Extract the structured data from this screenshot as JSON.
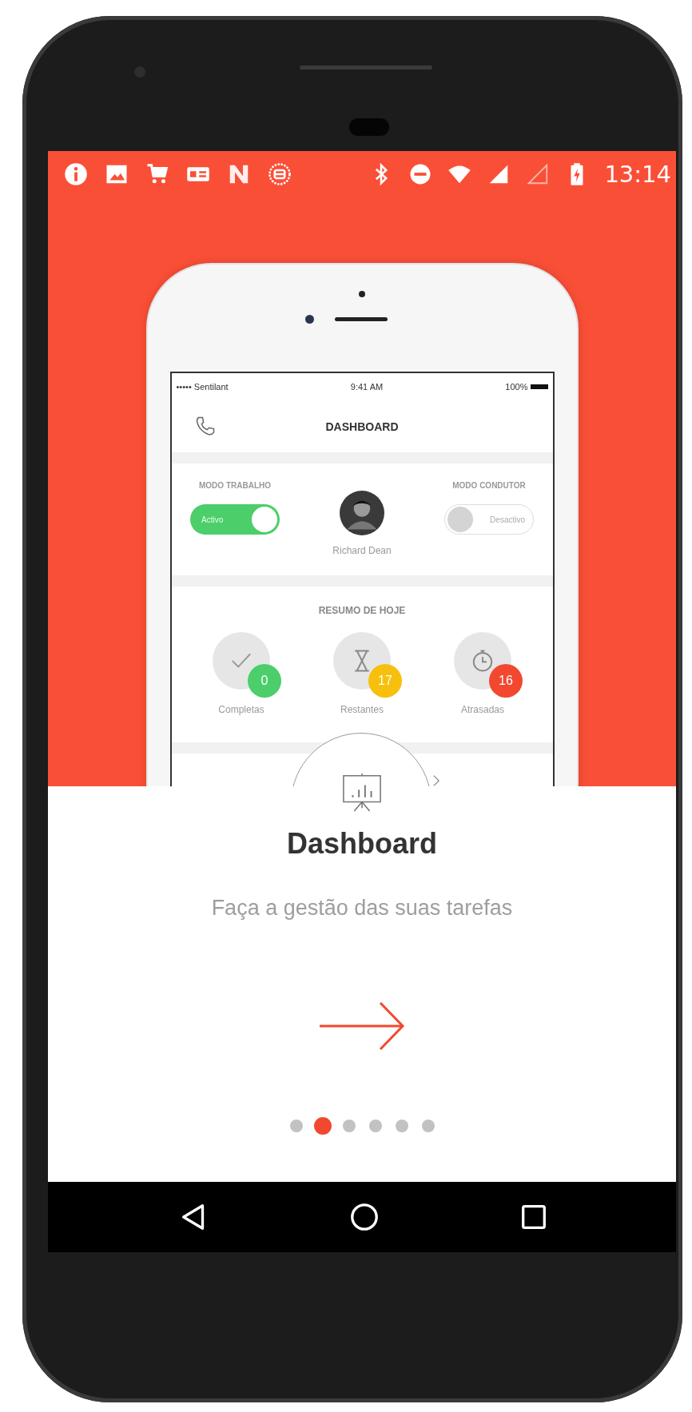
{
  "status_bar": {
    "time": "13:14"
  },
  "mockup": {
    "status": {
      "carrier": "••••• Sentilant",
      "time": "9:41 AM",
      "battery": "100%"
    },
    "title": "DASHBOARD",
    "modes": [
      {
        "label": "MODO TRABALHO",
        "toggle": "Activo",
        "on": true
      },
      {
        "label": "MODO CONDUTOR",
        "toggle": "Desactivo",
        "on": false
      }
    ],
    "user": {
      "name": "Richard Dean"
    },
    "summary": {
      "title": "RESUMO DE HOJE",
      "items": [
        {
          "kind": "check",
          "count": "0",
          "label": "Completas",
          "color": "#4cce6a"
        },
        {
          "kind": "hourglass",
          "count": "17",
          "label": "Restantes",
          "color": "#f6c00d"
        },
        {
          "kind": "timer",
          "count": "16",
          "label": "Atrasadas",
          "color": "#f2482f"
        }
      ]
    }
  },
  "onboarding": {
    "title": "Dashboard",
    "subtitle": "Faça a gestão das suas tarefas",
    "pages": [
      {
        "selected": false
      },
      {
        "selected": true
      },
      {
        "selected": false
      },
      {
        "selected": false
      },
      {
        "selected": false
      },
      {
        "selected": false
      }
    ]
  }
}
